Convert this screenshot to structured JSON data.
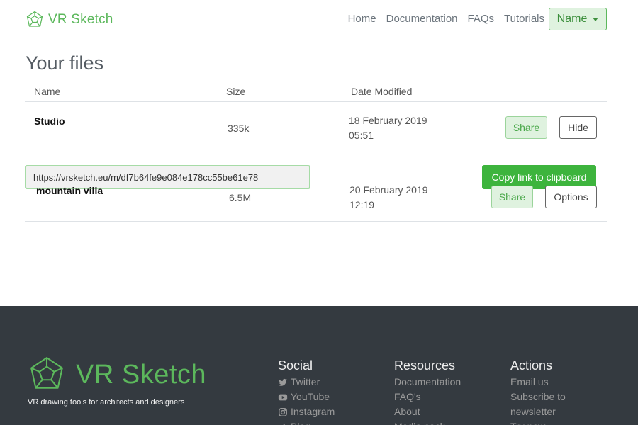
{
  "header": {
    "brand": "VR Sketch",
    "nav": [
      "Home",
      "Documentation",
      "FAQs",
      "Tutorials"
    ],
    "user_button": "Name"
  },
  "main": {
    "title": "Your files",
    "columns": [
      "Name",
      "Size",
      "Date Modified"
    ],
    "files": [
      {
        "name": "Studio",
        "size": "335k",
        "date": "18 February 2019",
        "time": "05:51",
        "share_label": "Share",
        "secondary_label": "Hide",
        "link": "https://vrsketch.eu/m/df7b64fe9e084e178cc55be61e78",
        "copy_label": "Copy link to clipboard"
      },
      {
        "name": "mountain villa",
        "size": "6.5M",
        "date": "20 February 2019",
        "time": "12:19",
        "share_label": "Share",
        "secondary_label": "Options"
      }
    ]
  },
  "footer": {
    "brand": "VR Sketch",
    "tagline": "VR drawing tools for architects and designers",
    "columns": [
      {
        "title": "Social",
        "links": [
          "Twitter",
          "YouTube",
          "Instagram",
          "Blog"
        ]
      },
      {
        "title": "Resources",
        "links": [
          "Documentation",
          "FAQ's",
          "About",
          "Media pack"
        ]
      },
      {
        "title": "Actions",
        "links": [
          "Email us",
          "Subscribe to",
          "newsletter",
          "Try now"
        ]
      }
    ]
  },
  "colors": {
    "brand_green": "#5cb85c",
    "success_button": "#3db43d",
    "footer_bg": "#343a40"
  }
}
